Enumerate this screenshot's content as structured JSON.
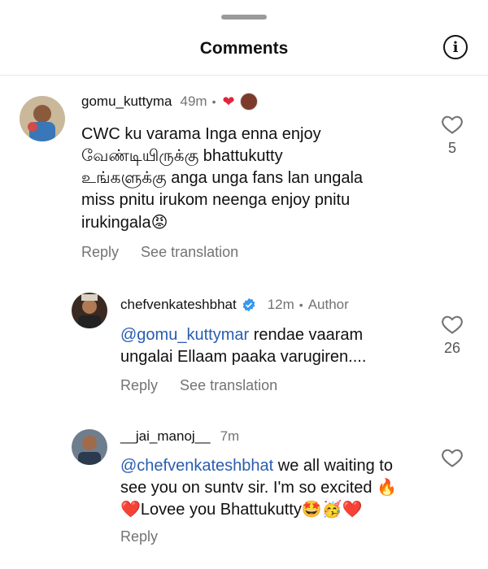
{
  "header": {
    "title": "Comments"
  },
  "comments": [
    {
      "username": "gomu_kuttyma",
      "time": "49m",
      "text_parts": [
        "CWC ku varama Inga enna enjoy\nவேண்டியிருக்கு bhattukutty\nஉங்களுக்கு anga unga fans lan ungala\nmiss pnitu irukom neenga enjoy pnitu\nirukingala",
        "😡"
      ],
      "reply_label": "Reply",
      "translation_label": "See translation",
      "like_count": "5"
    },
    {
      "username": "chefvenkateshbhat",
      "time": "12m",
      "author_label": "Author",
      "mention": "@gomu_kuttymar",
      "text": " rendae vaaram\nungalai Ellaam paaka varugiren....",
      "reply_label": "Reply",
      "translation_label": "See translation",
      "like_count": "26"
    },
    {
      "username": "__jai_manoj__",
      "time": "7m",
      "mention": "@chefvenkateshbhat",
      "text": " we all waiting to\nsee you on suntv sir. I'm so excited 🔥\n❤️Lovee you Bhattukutty🤩🥳❤️",
      "reply_label": "Reply"
    }
  ]
}
